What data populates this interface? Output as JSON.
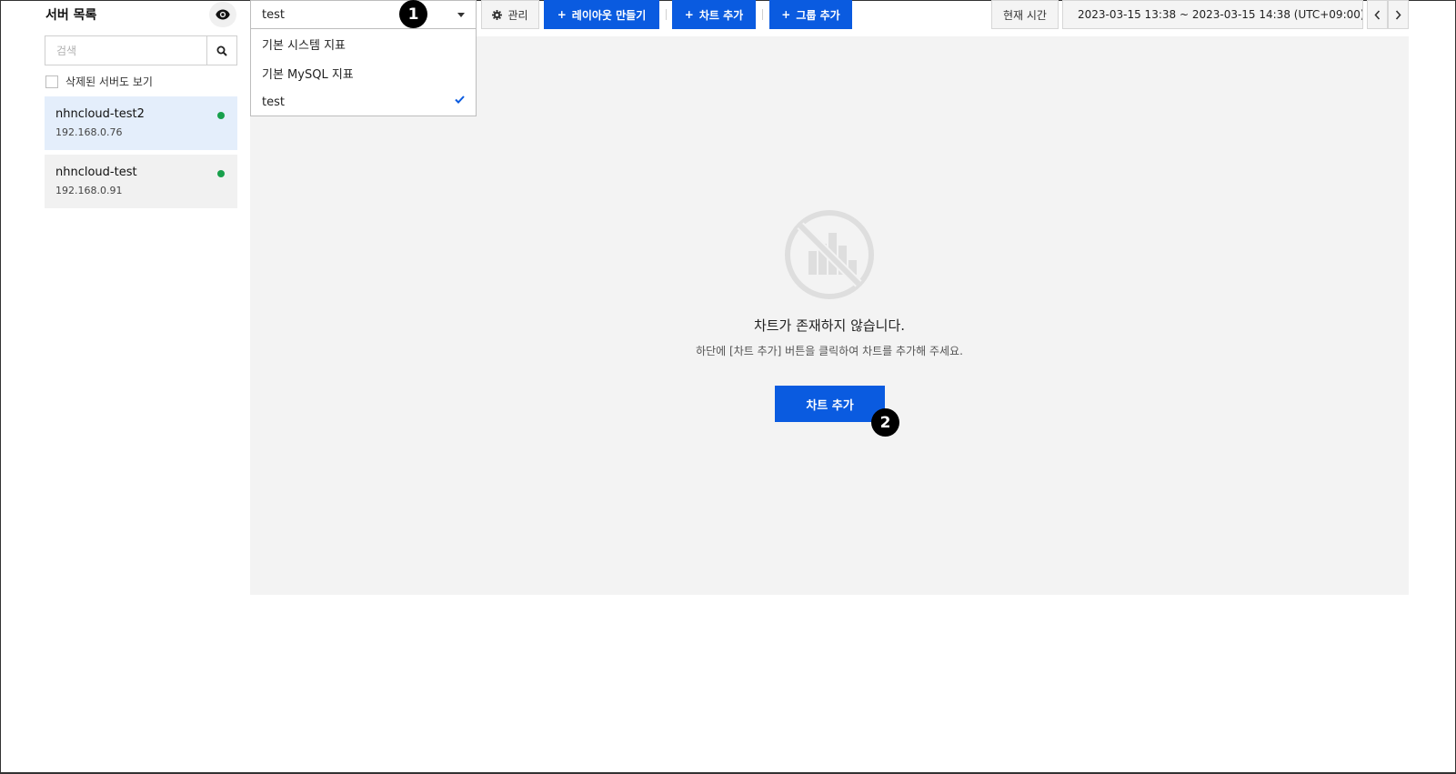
{
  "sidebar": {
    "title": "서버 목록",
    "visibility_icon": "eye-icon",
    "search": {
      "placeholder": "검색",
      "value": ""
    },
    "show_deleted_label": "삭제된 서버도 보기",
    "servers": [
      {
        "name": "nhncloud-test2",
        "ip": "192.168.0.76",
        "status": "online",
        "selected": true
      },
      {
        "name": "nhncloud-test",
        "ip": "192.168.0.91",
        "status": "online",
        "selected": false
      }
    ]
  },
  "toolbar": {
    "layout_select": {
      "value": "test",
      "options": [
        "기본 시스템 지표",
        "기본 MySQL 지표",
        "test"
      ],
      "selected_index": 2
    },
    "manage_label": "관리",
    "create_layout_label": "레이아웃 만들기",
    "add_chart_label": "차트 추가",
    "add_group_label": "그룹 추가",
    "current_time_label": "현재 시간",
    "time_range": "2023-03-15 13:38 ~ 2023-03-15 14:38 (UTC+09:00)"
  },
  "callouts": [
    "1",
    "2"
  ],
  "empty_state": {
    "title": "차트가 존재하지 않습니다.",
    "subtitle": "하단에 [차트 추가] 버튼을 클릭하여 차트를 추가해 주세요.",
    "button_label": "차트 추가",
    "icon": "no-chart-icon"
  },
  "colors": {
    "primary": "#0a5be0",
    "online": "#18a04c",
    "selected_bg": "#e4eefb",
    "panel_bg": "#f3f3f3"
  }
}
